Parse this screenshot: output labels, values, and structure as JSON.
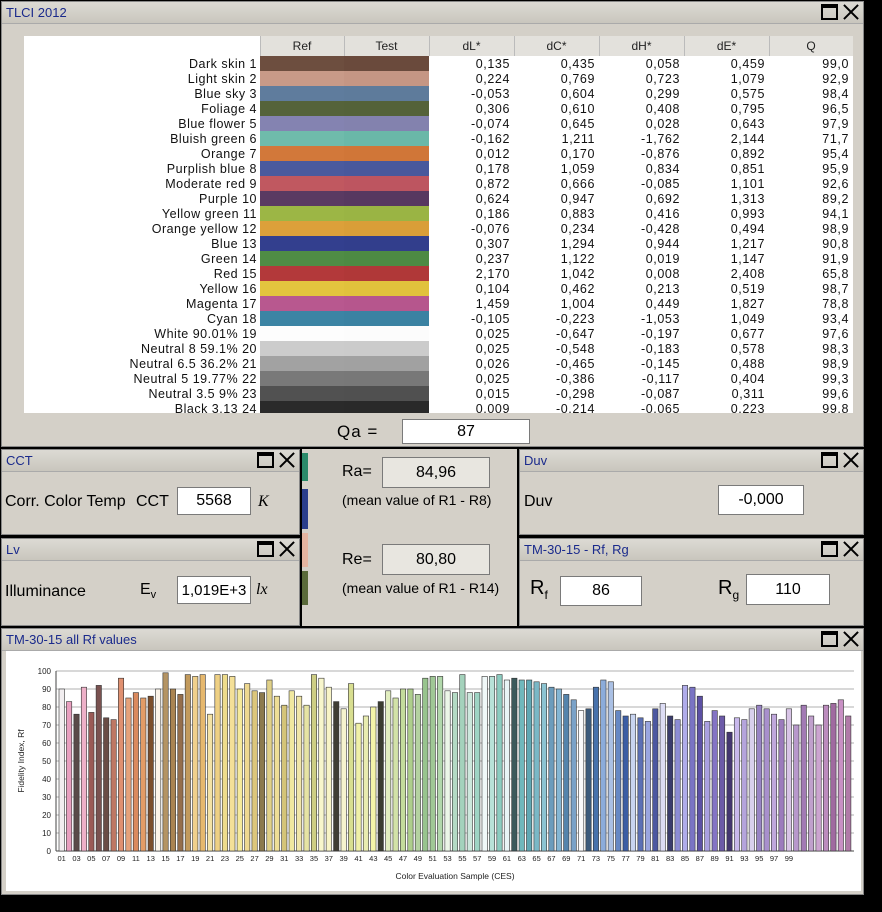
{
  "tlci": {
    "title": "TLCI 2012",
    "headers": [
      "Ref",
      "Test",
      "dL*",
      "dC*",
      "dH*",
      "dE*",
      "Q"
    ],
    "rows": [
      {
        "name": "Dark skin 1",
        "ref": "#6d4e3f",
        "test": "#6a4a3c",
        "dL": "0,135",
        "dC": "0,435",
        "dH": "0,058",
        "dE": "0,459",
        "Q": "99,0"
      },
      {
        "name": "Light skin 2",
        "ref": "#c89a88",
        "test": "#c59684",
        "dL": "0,224",
        "dC": "0,769",
        "dH": "0,723",
        "dE": "1,079",
        "Q": "92,9"
      },
      {
        "name": "Blue sky 3",
        "ref": "#5f7c9d",
        "test": "#5e7b9b",
        "dL": "-0,053",
        "dC": "0,604",
        "dH": "0,299",
        "dE": "0,575",
        "Q": "98,4"
      },
      {
        "name": "Foliage 4",
        "ref": "#55633a",
        "test": "#546239",
        "dL": "0,306",
        "dC": "0,610",
        "dH": "0,408",
        "dE": "0,795",
        "Q": "96,5"
      },
      {
        "name": "Blue flower 5",
        "ref": "#8483b1",
        "test": "#8382ae",
        "dL": "-0,074",
        "dC": "0,645",
        "dH": "0,028",
        "dE": "0,643",
        "Q": "97,9"
      },
      {
        "name": "Bluish green 6",
        "ref": "#6fbbab",
        "test": "#6ab8a8",
        "dL": "-0,162",
        "dC": "1,211",
        "dH": "-1,762",
        "dE": "2,144",
        "Q": "71,7"
      },
      {
        "name": "Orange 7",
        "ref": "#d2783a",
        "test": "#d07638",
        "dL": "0,012",
        "dC": "0,170",
        "dH": "-0,876",
        "dE": "0,892",
        "Q": "95,4"
      },
      {
        "name": "Purplish blue 8",
        "ref": "#4a5a9e",
        "test": "#48589c",
        "dL": "0,178",
        "dC": "1,059",
        "dH": "0,834",
        "dE": "0,851",
        "Q": "95,9"
      },
      {
        "name": "Moderate red 9",
        "ref": "#c05860",
        "test": "#bd5560",
        "dL": "0,872",
        "dC": "0,666",
        "dH": "-0,085",
        "dE": "1,101",
        "Q": "92,6"
      },
      {
        "name": "Purple 10",
        "ref": "#5a3a62",
        "test": "#573860",
        "dL": "0,624",
        "dC": "0,947",
        "dH": "0,692",
        "dE": "1,313",
        "Q": "89,2"
      },
      {
        "name": "Yellow green 11",
        "ref": "#9cb645",
        "test": "#9ab444",
        "dL": "0,186",
        "dC": "0,883",
        "dH": "0,416",
        "dE": "0,993",
        "Q": "94,1"
      },
      {
        "name": "Orange yellow 12",
        "ref": "#dca03a",
        "test": "#d99e38",
        "dL": "-0,076",
        "dC": "0,234",
        "dH": "-0,428",
        "dE": "0,494",
        "Q": "98,9"
      },
      {
        "name": "Blue 13",
        "ref": "#333f8e",
        "test": "#323e8c",
        "dL": "0,307",
        "dC": "1,294",
        "dH": "0,944",
        "dE": "1,217",
        "Q": "90,8"
      },
      {
        "name": "Green 14",
        "ref": "#4f8c45",
        "test": "#4d8a43",
        "dL": "0,237",
        "dC": "1,122",
        "dH": "0,019",
        "dE": "1,147",
        "Q": "91,9"
      },
      {
        "name": "Red 15",
        "ref": "#b3393a",
        "test": "#b03838",
        "dL": "2,170",
        "dC": "1,042",
        "dH": "0,008",
        "dE": "2,408",
        "Q": "65,8"
      },
      {
        "name": "Yellow 16",
        "ref": "#e3c43e",
        "test": "#e1c23c",
        "dL": "0,104",
        "dC": "0,462",
        "dH": "0,213",
        "dE": "0,519",
        "Q": "98,7"
      },
      {
        "name": "Magenta 17",
        "ref": "#b8588f",
        "test": "#b6568d",
        "dL": "1,459",
        "dC": "1,004",
        "dH": "0,449",
        "dE": "1,827",
        "Q": "78,8"
      },
      {
        "name": "Cyan 18",
        "ref": "#3c84a4",
        "test": "#3b82a2",
        "dL": "-0,105",
        "dC": "-0,223",
        "dH": "-1,053",
        "dE": "1,049",
        "Q": "93,4"
      },
      {
        "name": "White 90.01% 19",
        "ref": "#fdfdfd",
        "test": "#fcfcfc",
        "dL": "0,025",
        "dC": "-0,647",
        "dH": "-0,197",
        "dE": "0,677",
        "Q": "97,6"
      },
      {
        "name": "Neutral 8 59.1% 20",
        "ref": "#cccccc",
        "test": "#cbcbcb",
        "dL": "0,025",
        "dC": "-0,548",
        "dH": "-0,183",
        "dE": "0,578",
        "Q": "98,3"
      },
      {
        "name": "Neutral 6.5 36.2% 21",
        "ref": "#a2a2a2",
        "test": "#a1a1a1",
        "dL": "0,026",
        "dC": "-0,465",
        "dH": "-0,145",
        "dE": "0,488",
        "Q": "98,9"
      },
      {
        "name": "Neutral 5 19.77% 22",
        "ref": "#797979",
        "test": "#787878",
        "dL": "0,025",
        "dC": "-0,386",
        "dH": "-0,117",
        "dE": "0,404",
        "Q": "99,3"
      },
      {
        "name": "Neutral 3.5 9% 23",
        "ref": "#515151",
        "test": "#505050",
        "dL": "0,015",
        "dC": "-0,298",
        "dH": "-0,087",
        "dE": "0,311",
        "Q": "99,6"
      },
      {
        "name": "Black 3.13 24",
        "ref": "#2a2a2a",
        "test": "#292929",
        "dL": "0,009",
        "dC": "-0,214",
        "dH": "-0,065",
        "dE": "0,223",
        "Q": "99,8"
      }
    ],
    "qa_label": "Qa =",
    "qa_value": "87"
  },
  "cct": {
    "title": "CCT",
    "label": "Corr. Color Temp",
    "short": "CCT",
    "value": "5568",
    "unit": "K"
  },
  "lv": {
    "title": "Lv",
    "label": "Illuminance",
    "sym": "E",
    "sub": "v",
    "value": "1,019E+3",
    "unit": "lx"
  },
  "ra": {
    "label": "Ra=",
    "value": "84,96",
    "desc": "(mean value of R1 - R8)"
  },
  "re": {
    "label": "Re=",
    "value": "80,80",
    "desc": "(mean value of R1 - R14)"
  },
  "duv": {
    "title": "Duv",
    "label": "Duv",
    "value": "-0,000"
  },
  "tm": {
    "title": "TM-30-15 - Rf, Rg",
    "rf_sym": "R",
    "rf_sub": "f",
    "rf_value": "86",
    "rg_sym": "R",
    "rg_sub": "g",
    "rg_value": "110"
  },
  "rfpanel": {
    "title": "TM-30-15 all Rf values"
  },
  "chart_data": {
    "type": "bar",
    "xlabel": "Color Evaluation Sample (CES)",
    "ylabel": "Fidelity Index, Rf",
    "ylim": [
      0,
      100
    ],
    "yticks": [
      0,
      10,
      20,
      30,
      40,
      50,
      60,
      70,
      80,
      90,
      100
    ],
    "tick_labels": [
      "01",
      "03",
      "05",
      "07",
      "09",
      "11",
      "13",
      "15",
      "17",
      "19",
      "21",
      "23",
      "25",
      "27",
      "29",
      "31",
      "33",
      "35",
      "37",
      "39",
      "41",
      "43",
      "45",
      "47",
      "49",
      "51",
      "53",
      "55",
      "57",
      "59",
      "61",
      "63",
      "65",
      "67",
      "69",
      "71",
      "73",
      "75",
      "77",
      "79",
      "81",
      "83",
      "85",
      "87",
      "89",
      "91",
      "93",
      "95",
      "97",
      "99"
    ],
    "values": [
      90,
      83,
      76,
      91,
      77,
      92,
      74,
      73,
      96,
      85,
      88,
      85,
      86,
      90,
      99,
      90,
      87,
      98,
      97,
      98,
      76,
      98,
      98,
      97,
      90,
      93,
      89,
      88,
      95,
      86,
      81,
      89,
      86,
      81,
      98,
      96,
      91,
      83,
      79,
      93,
      71,
      75,
      80,
      83,
      89,
      85,
      90,
      90,
      87,
      96,
      97,
      97,
      89,
      88,
      98,
      88,
      88,
      97,
      97,
      98,
      95,
      96,
      95,
      95,
      94,
      93,
      91,
      90,
      87,
      84,
      78,
      79,
      91,
      95,
      94,
      78,
      75,
      76,
      74,
      72,
      79,
      82,
      75,
      73,
      92,
      91,
      86,
      72,
      78,
      75,
      66,
      74,
      73,
      79,
      81,
      79,
      76,
      73,
      79,
      70,
      81,
      75,
      70,
      81,
      82,
      84,
      75
    ],
    "colors": [
      "#f2eef0",
      "#e9a0c0",
      "#5a4a48",
      "#eeb0c8",
      "#9a5a56",
      "#7a5250",
      "#6a4d46",
      "#be7864",
      "#e09070",
      "#e6a27a",
      "#da8a5e",
      "#e39c66",
      "#7a4e2c",
      "#fbf4ea",
      "#b49464",
      "#aa8452",
      "#946e4c",
      "#c29a5c",
      "#f0d08c",
      "#e6b86e",
      "#f4e2a4",
      "#eed084",
      "#eedc8c",
      "#f4e098",
      "#f6ea9a",
      "#eed890",
      "#dcc67c",
      "#8c7a4e",
      "#e0d088",
      "#eede96",
      "#d4c478",
      "#f0e8a0",
      "#f0e6a8",
      "#e6e4a4",
      "#cece84",
      "#f8f6cc",
      "#f8f4c6",
      "#403e34",
      "#f6f4ce",
      "#d8de90",
      "#f0f0a8",
      "#e8ecb0",
      "#f4f4a8",
      "#3a3c30",
      "#e2eec0",
      "#d2e2a8",
      "#c4dc9c",
      "#aece8c",
      "#b4d2a0",
      "#98c48e",
      "#a0c896",
      "#b2d8ac",
      "#ecf6e8",
      "#b4dac4",
      "#a4d2bc",
      "#cce8dc",
      "#9ed4c4",
      "#f0f8f8",
      "#b8e2d8",
      "#8cccc0",
      "#e8f4f6",
      "#3c5a5c",
      "#70b8bc",
      "#60a8b4",
      "#7ab8c6",
      "#8cc4d2",
      "#6c9cbc",
      "#84b6d4",
      "#5484ac",
      "#7aa2c8",
      "#fafafc",
      "#3c5a7c",
      "#4872ac",
      "#8cacda",
      "#aac0e4",
      "#6688c4",
      "#3c5ea4",
      "#c8d4f0",
      "#5c70b4",
      "#9aa6e0",
      "#4c58a0",
      "#dcdcf4",
      "#3a3c6c",
      "#8c8cd4",
      "#b0acea",
      "#7a74c4",
      "#5c50a4",
      "#aaa0e0",
      "#8474c4",
      "#6c5aa8",
      "#443670",
      "#c8b8ec",
      "#b4a4dc",
      "#d8d0ec",
      "#9884c4",
      "#a890cc",
      "#c0a8dc",
      "#9c7cbc",
      "#d8c4e6",
      "#b898cc",
      "#a27ab4",
      "#c0a0cc",
      "#cca4d0",
      "#bc8cbe",
      "#a06aa0",
      "#c890c4",
      "#b07aa8"
    ]
  }
}
